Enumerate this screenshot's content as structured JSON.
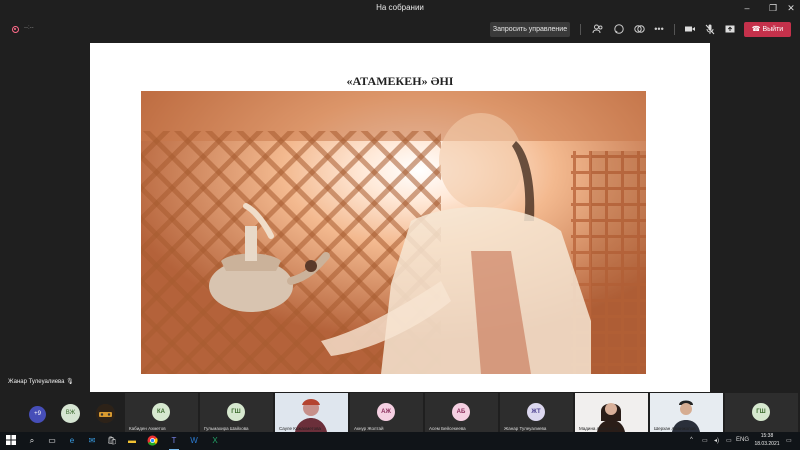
{
  "window": {
    "title": "На собрании"
  },
  "toolbar": {
    "timer": "--:--",
    "request_control": "Запросить управление",
    "leave": "Выйти",
    "icons": [
      "participants-icon",
      "chat-icon",
      "reactions-icon",
      "more-icon",
      "camera-icon",
      "mic-off-icon",
      "share-icon",
      "phone-hangup-icon"
    ]
  },
  "slide": {
    "title": "«АТАМЕКЕН» ӘНІ"
  },
  "speaker": {
    "name": "Жанар Тулеуалиева"
  },
  "participants": {
    "more": "+9",
    "small": [
      {
        "initials": "ВЖ",
        "color": "#d6e5d2"
      }
    ],
    "tiles": [
      {
        "name": "Кабиден Ахметов",
        "initials": "КА",
        "avatar_bg": "#d6e8cf",
        "avatar_fg": "#3c6c2e",
        "video": false
      },
      {
        "name": "Гульмахира Шайхова",
        "initials": "ГШ",
        "avatar_bg": "#d6e8cf",
        "avatar_fg": "#3c6c2e",
        "video": false
      },
      {
        "name": "Сауле Кожахметова",
        "initials": "",
        "video": true
      },
      {
        "name": "Акнур Жолтай",
        "initials": "АЖ",
        "avatar_bg": "#f5d0e2",
        "avatar_fg": "#8a2d5b",
        "video": false
      },
      {
        "name": "Асем Бейсекеева",
        "initials": "АБ",
        "avatar_bg": "#f5d0e2",
        "avatar_fg": "#8a2d5b",
        "video": false
      },
      {
        "name": "Жанар Тулеуалиева",
        "initials": "ЖТ",
        "avatar_bg": "#dcd8ef",
        "avatar_fg": "#4b3f8f",
        "video": false
      },
      {
        "name": "Мадина Аманкелді",
        "initials": "",
        "video": true
      },
      {
        "name": "Шерхан Аманжолов",
        "initials": "",
        "video": true
      },
      {
        "name": "",
        "initials": "ГШ",
        "avatar_bg": "#d6e8cf",
        "avatar_fg": "#3c6c2e",
        "video": false
      }
    ]
  },
  "taskbar": {
    "lang": "ENG",
    "time": "15:38",
    "date": "18.03.2021"
  }
}
